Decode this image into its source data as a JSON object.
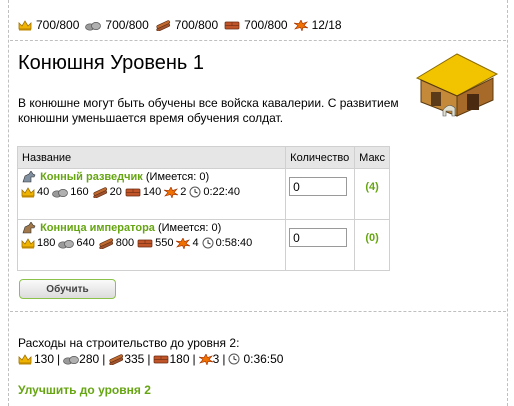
{
  "resources": [
    {
      "icon": "crown-icon",
      "value": "700/800"
    },
    {
      "icon": "stone-icon",
      "value": "700/800"
    },
    {
      "icon": "wood-icon",
      "value": "700/800"
    },
    {
      "icon": "brick-icon",
      "value": "700/800"
    },
    {
      "icon": "population-icon",
      "value": "12/18"
    }
  ],
  "page": {
    "title": "Конюшня Уровень 1",
    "description": "В конюшне могут быть обучены все войска кавалерии. С развитием конюшни уменьшается время обучения солдат."
  },
  "table": {
    "headers": [
      "Название",
      "Количество",
      "Макс"
    ],
    "rows": [
      {
        "name": "Конный разведчик",
        "have": "(Имеется: 0)",
        "costs": [
          "40",
          "160",
          "20",
          "140",
          "2",
          "0:22:40"
        ],
        "qty": "0",
        "max": "(4)"
      },
      {
        "name": "Конница императора",
        "have": "(Имеется: 0)",
        "costs": [
          "180",
          "640",
          "800",
          "550",
          "4",
          "0:58:40"
        ],
        "qty": "0",
        "max": "(0)"
      }
    ]
  },
  "train_button": "Обучить",
  "build_cost": {
    "label": "Расходы на строительство до уровня 2:",
    "values": [
      "130",
      "280",
      "335",
      "180",
      "3",
      "0:36:50"
    ]
  },
  "upgrade_link": "Улучшить до уровня 2",
  "colors": {
    "accent": "#66a512",
    "header_bg": "#e6e6e6"
  }
}
